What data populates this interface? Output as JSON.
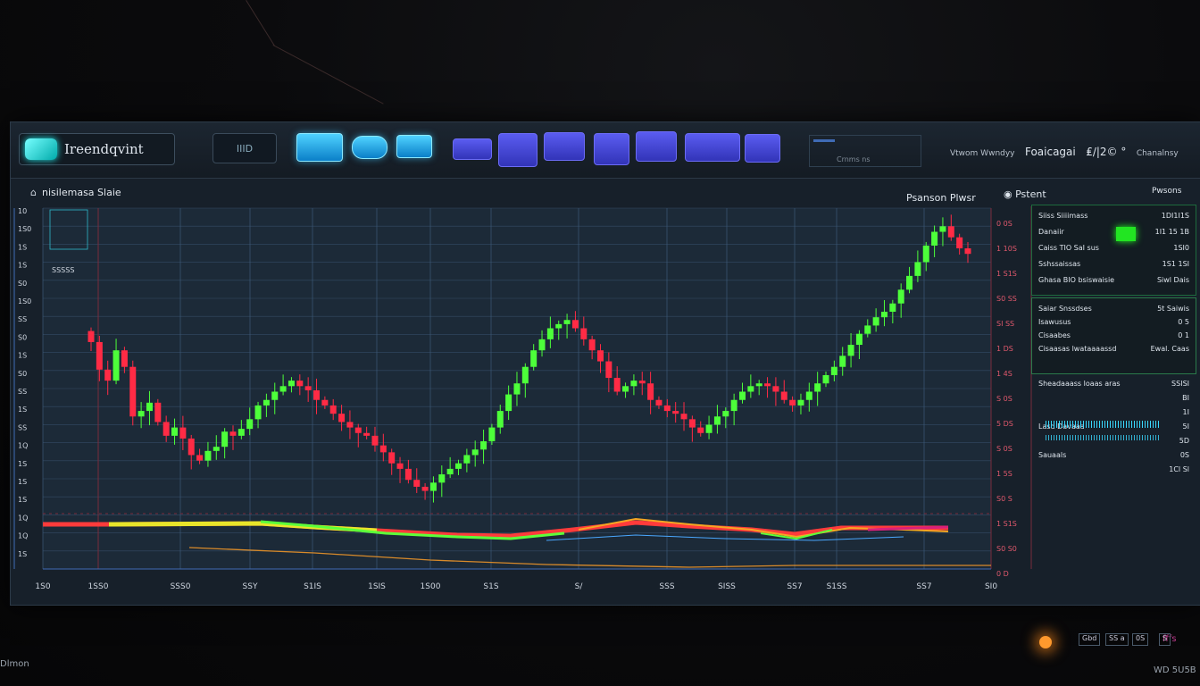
{
  "app": {
    "logo_text": "Ireendqvint",
    "mini_button_label": "IIID",
    "toolbar_right": {
      "label_a": "Vtwom Wwndyy",
      "label_b": "Foaicagai",
      "label_c": "₤/|2© °",
      "label_d": "Chanalnsy"
    },
    "info_box_text": "Crnms ns"
  },
  "chart_panel": {
    "title": "nisilemasa Slaie",
    "right_header_a": "Psanson Plwsr",
    "right_header_b": "Pstent",
    "right_header_c": "Pwsons",
    "left_box_label": "SSSSS"
  },
  "side_panel": {
    "rows_a": [
      {
        "label": "Siiss Siiiimass",
        "value": "1DI1I1S"
      },
      {
        "label": "Danaiir",
        "value": "1I1 15 1B"
      },
      {
        "label": "Caiss TIO SaI sus",
        "value": "1SI0"
      },
      {
        "label": "Sshssaissas",
        "value": "1S1 1SI"
      },
      {
        "label": "Ghasa BIO bsiswaisie",
        "value": "Siwl Dais"
      }
    ],
    "rows_b": [
      {
        "label": "Saiar Snssdses",
        "value": "5t Saiwis"
      },
      {
        "label": "Isawusus",
        "value": "0 5"
      },
      {
        "label": "Cisaabes",
        "value": "0 1"
      },
      {
        "label": "Cisaasas lwataaaassd",
        "value": "Ewal. Caas"
      }
    ],
    "rows_c": [
      {
        "label": "Sheadaaass loaas aras",
        "value": "SSISI"
      },
      {
        "label": "",
        "value": "BI"
      },
      {
        "label": "",
        "value": "1I"
      },
      {
        "label": "Lasd Davaaa",
        "value": "5I"
      },
      {
        "label": "",
        "value": "5D"
      },
      {
        "label": "Sauaals",
        "value": "0S"
      },
      {
        "label": "",
        "value": "1Cl Sl"
      }
    ],
    "footer_buttons": [
      "Gbd",
      "SS a",
      "0S",
      "S"
    ]
  },
  "corner": {
    "bottom_left": "Dlmon",
    "bottom_right_a": "fffs",
    "bottom_right_b": "WD 5U5B"
  },
  "chart_data": {
    "type": "candlestick",
    "colors": {
      "up": "#4dff3a",
      "down": "#ff2b45",
      "grid": "#3d5a78"
    },
    "y_ticks": [
      "10",
      "1S0",
      "1S",
      "1S",
      "S0",
      "1S0",
      "SS",
      "S0",
      "1S",
      "S0",
      "SS",
      "1S",
      "SS",
      "1Q",
      "1S",
      "1S",
      "1S",
      "1Q",
      "1Q",
      "1S"
    ],
    "right_y_ticks": [
      "0 0S",
      "1 10S",
      "1 S1S",
      "S0 SS",
      "SI SS",
      "1 DS",
      "1 4S",
      "S 0S",
      "5 DS",
      "S 0S",
      "1 5S",
      "S0 S",
      "1 S1S",
      "S0 S0",
      "0 D"
    ],
    "x_labels": [
      "1S0",
      "1SS0",
      "SSS0",
      "SSY",
      "S1IS",
      "1SIS",
      "1S00",
      "S1S",
      "S/",
      "SSS",
      "SISS",
      "SS7",
      "S1SS",
      "SS7",
      "SI0"
    ],
    "closes": [
      268,
      248,
      240,
      262,
      250,
      214,
      218,
      224,
      210,
      200,
      206,
      198,
      186,
      182,
      189,
      192,
      203,
      200,
      205,
      212,
      222,
      226,
      232,
      236,
      240,
      236,
      233,
      226,
      222,
      216,
      210,
      206,
      202,
      200,
      193,
      188,
      180,
      176,
      168,
      163,
      160,
      166,
      172,
      176,
      180,
      186,
      190,
      196,
      206,
      218,
      230,
      238,
      250,
      262,
      270,
      278,
      281,
      284,
      278,
      270,
      262,
      254,
      242,
      232,
      236,
      240,
      238,
      226,
      222,
      218,
      216,
      212,
      206,
      202,
      208,
      214,
      218,
      226,
      232,
      236,
      238,
      236,
      232,
      226,
      222,
      226,
      232,
      238,
      244,
      250,
      258,
      266,
      274,
      280,
      286,
      290,
      296,
      306,
      316,
      326,
      338,
      348,
      352,
      344,
      336,
      332
    ],
    "indicator_1": [
      0,
      0,
      0,
      0,
      0,
      0,
      0,
      0,
      0,
      0,
      0,
      0
    ],
    "indicator_2": [
      4,
      4,
      2,
      -1,
      -3,
      -6,
      -7,
      -7,
      -8,
      -10,
      -9,
      -7
    ]
  }
}
